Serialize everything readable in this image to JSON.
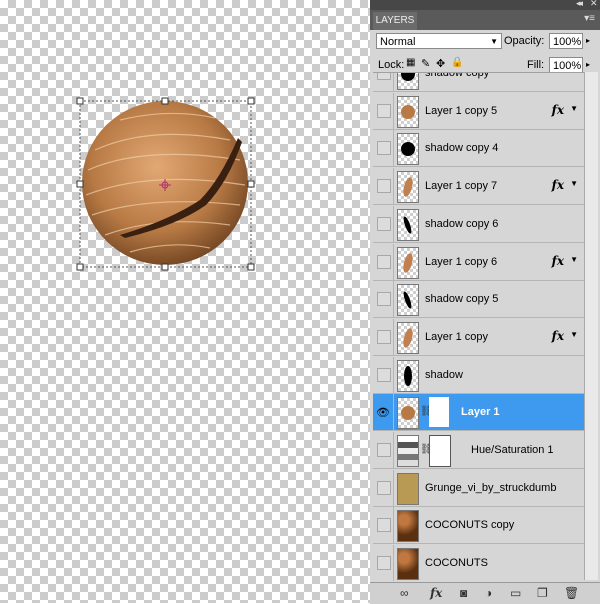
{
  "panel": {
    "tab": "LAYERS",
    "blend_mode": "Normal",
    "opacity_label": "Opacity:",
    "opacity_value": "100%",
    "lock_label": "Lock:",
    "fill_label": "Fill:",
    "fill_value": "100%"
  },
  "layers": [
    {
      "name": "shadow copy",
      "thumb": "blob",
      "visible": false,
      "fx": false
    },
    {
      "name": "Layer 1 copy 5",
      "thumb": "nut-round",
      "visible": false,
      "fx": true
    },
    {
      "name": "shadow copy 4",
      "thumb": "blob",
      "visible": false,
      "fx": false
    },
    {
      "name": "Layer 1 copy 7",
      "thumb": "nut-slice",
      "visible": false,
      "fx": true
    },
    {
      "name": "shadow copy 6",
      "thumb": "slash",
      "visible": false,
      "fx": false
    },
    {
      "name": "Layer 1 copy 6",
      "thumb": "nut-slice",
      "visible": false,
      "fx": true
    },
    {
      "name": "shadow copy 5",
      "thumb": "slash",
      "visible": false,
      "fx": false
    },
    {
      "name": "Layer 1 copy",
      "thumb": "nut-slice",
      "visible": false,
      "fx": true
    },
    {
      "name": "shadow",
      "thumb": "blob-tall",
      "visible": false,
      "fx": false
    },
    {
      "name": "Layer 1",
      "thumb": "nut-round",
      "visible": true,
      "fx": false,
      "selected": true,
      "mask": true
    },
    {
      "name": "Hue/Saturation 1",
      "thumb": "adjustment",
      "visible": false,
      "fx": false,
      "mask": true
    },
    {
      "name": "Grunge_vi_by_struckdumb",
      "thumb": "grunge",
      "visible": false,
      "fx": false
    },
    {
      "name": "COCONUTS copy",
      "thumb": "coconuts",
      "visible": false,
      "fx": false
    },
    {
      "name": "COCONUTS",
      "thumb": "coconuts",
      "visible": false,
      "fx": false
    }
  ],
  "icons": [
    "link-icon",
    "fx-icon",
    "mask-icon",
    "adjustment-icon",
    "group-icon",
    "new-layer-icon",
    "trash-icon"
  ],
  "colors": {
    "selection": "#3d9aee",
    "panel_bg": "#d6d6d6"
  }
}
